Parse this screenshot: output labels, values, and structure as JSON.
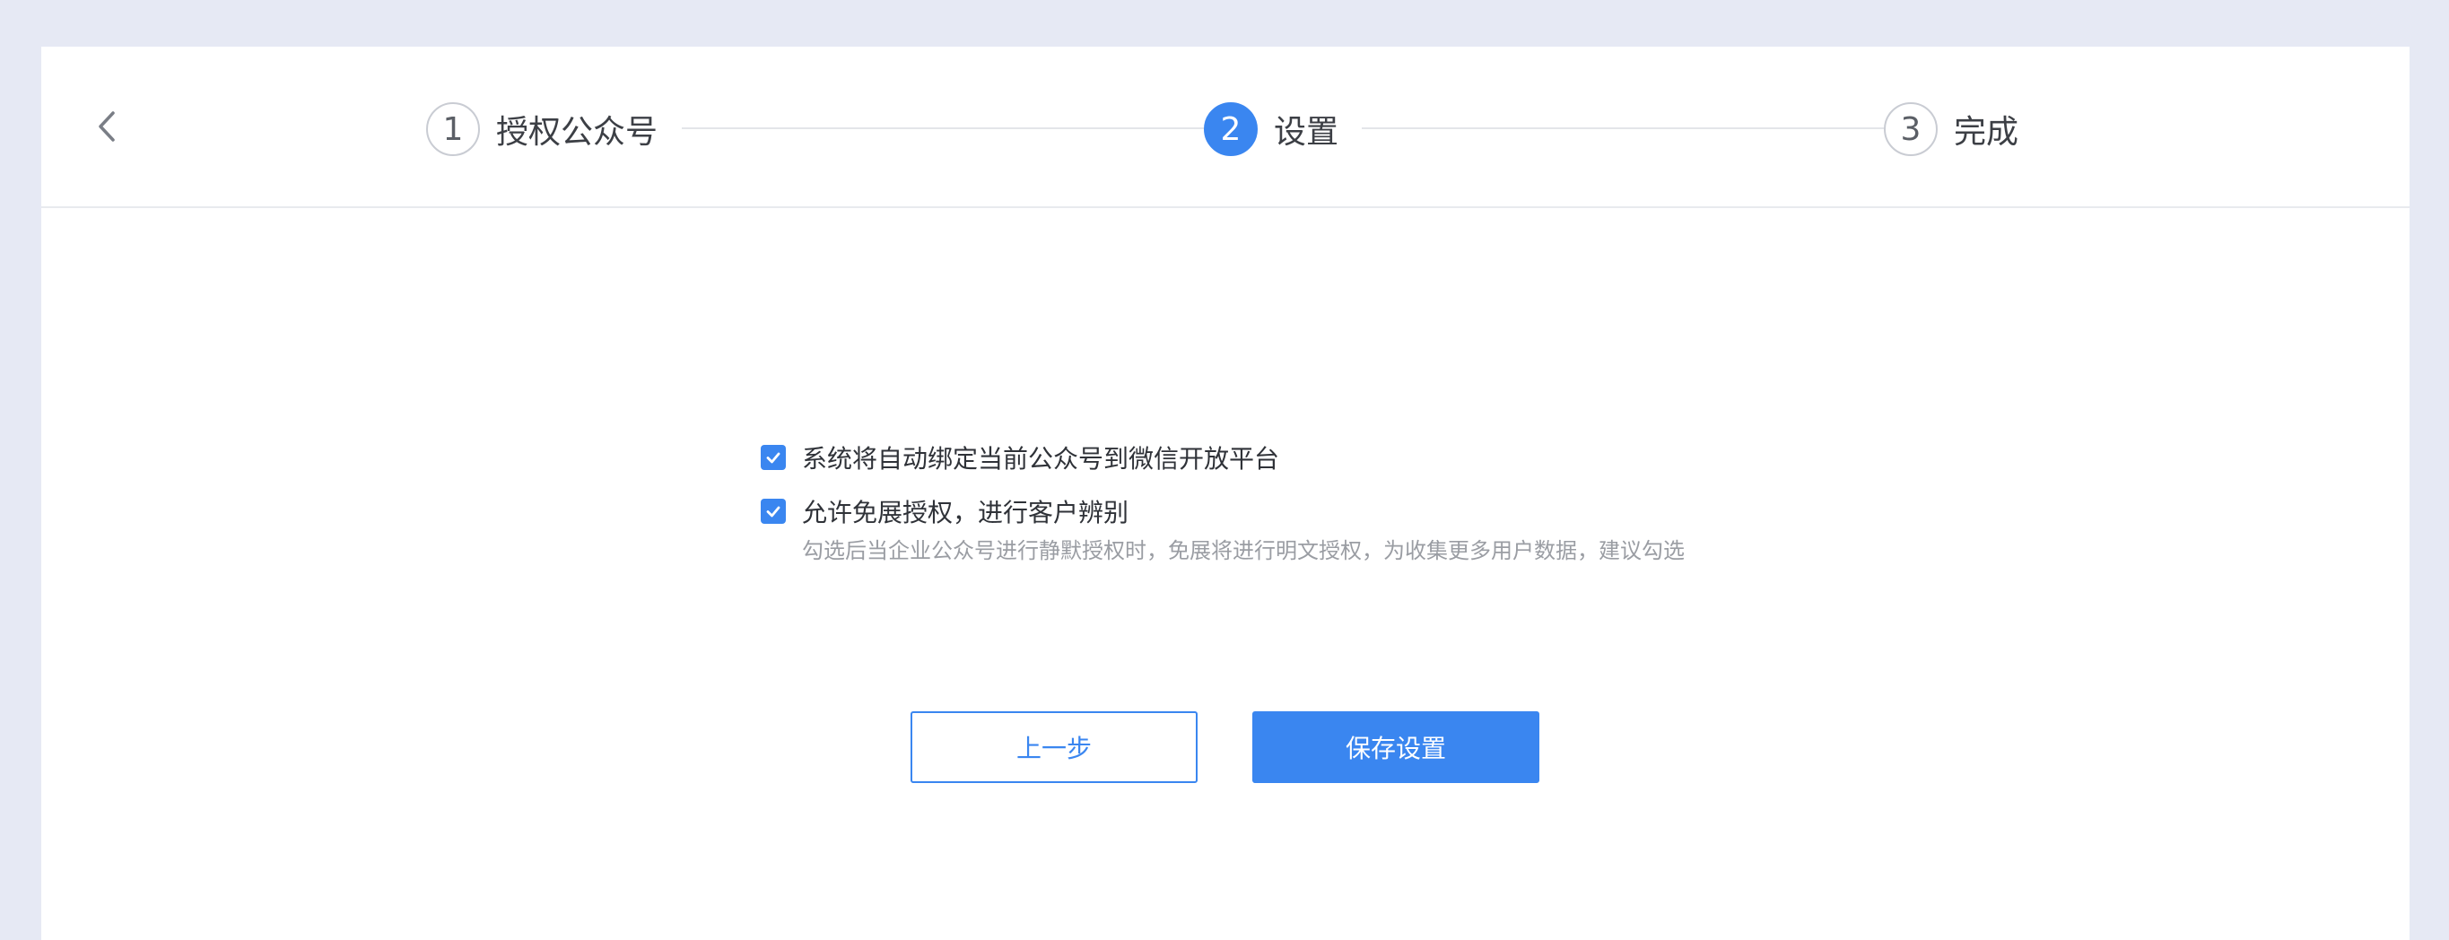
{
  "header": {
    "back_icon": "chevron-left-icon",
    "steps": [
      {
        "number": "1",
        "label": "授权公众号",
        "state": "done"
      },
      {
        "number": "2",
        "label": "设置",
        "state": "active"
      },
      {
        "number": "3",
        "label": "完成",
        "state": "pending"
      }
    ]
  },
  "options": [
    {
      "label": "系统将自动绑定当前公众号到微信开放平台",
      "checked": true,
      "hint": ""
    },
    {
      "label": "允许免展授权，进行客户辨别",
      "checked": true,
      "hint": "勾选后当企业公众号进行静默授权时，免展将进行明文授权，为收集更多用户数据，建议勾选"
    }
  ],
  "buttons": {
    "prev_label": "上一步",
    "save_label": "保存设置"
  },
  "colors": {
    "accent": "#3a86f0",
    "background": "#e6e9f4",
    "panel": "#ffffff"
  }
}
